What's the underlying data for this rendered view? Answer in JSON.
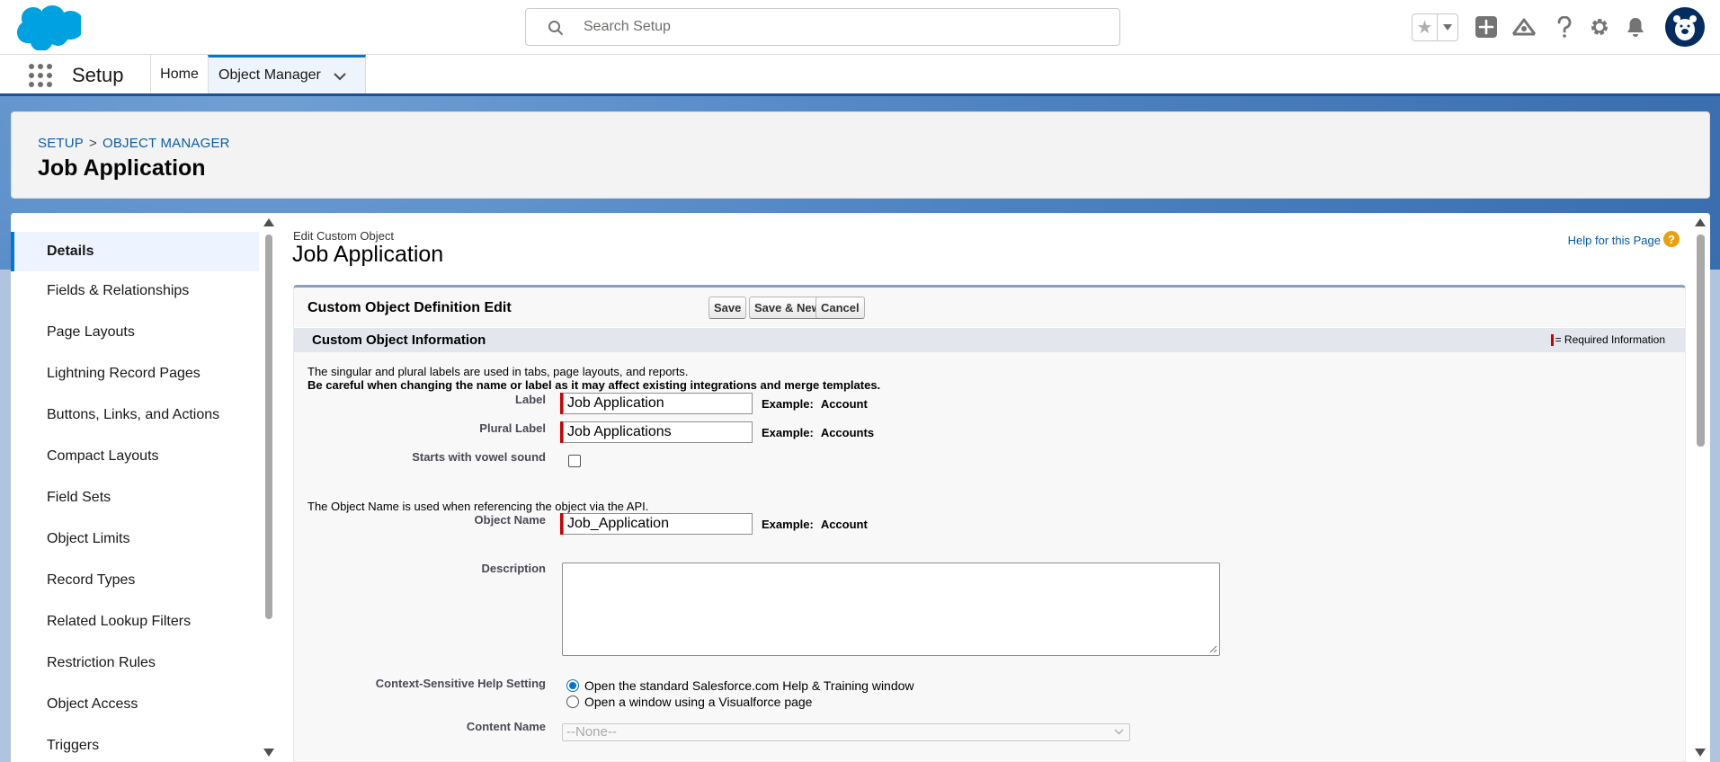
{
  "header": {
    "search_placeholder": "Search Setup",
    "icons": [
      "favorites-star-icon",
      "favorites-dropdown-icon",
      "global-create-icon",
      "trailhead-icon",
      "help-icon",
      "setup-gear-icon",
      "notifications-bell-icon",
      "user-avatar"
    ]
  },
  "context_bar": {
    "app_name": "Setup",
    "tabs": [
      {
        "label": "Home"
      },
      {
        "label": "Object Manager"
      }
    ]
  },
  "page_header": {
    "breadcrumb": [
      "SETUP",
      "OBJECT MANAGER"
    ],
    "breadcrumb_separator": ">",
    "title": "Job Application"
  },
  "sidebar": {
    "items": [
      {
        "label": "Details",
        "active": true
      },
      {
        "label": "Fields & Relationships"
      },
      {
        "label": "Page Layouts"
      },
      {
        "label": "Lightning Record Pages"
      },
      {
        "label": "Buttons, Links, and Actions"
      },
      {
        "label": "Compact Layouts"
      },
      {
        "label": "Field Sets"
      },
      {
        "label": "Object Limits"
      },
      {
        "label": "Record Types"
      },
      {
        "label": "Related Lookup Filters"
      },
      {
        "label": "Restriction Rules"
      },
      {
        "label": "Object Access"
      },
      {
        "label": "Triggers"
      }
    ]
  },
  "content": {
    "edit_label": "Edit Custom Object",
    "edit_title": "Job Application",
    "help_link": "Help for this Page",
    "help_icon_glyph": "?",
    "block_title": "Custom Object Definition Edit",
    "buttons": {
      "save": "Save",
      "save_new": "Save & New",
      "cancel": "Cancel"
    },
    "section_title": "Custom Object Information",
    "required_info": "= Required Information",
    "note_1": "The singular and plural labels are used in tabs, page layouts, and reports.",
    "note_2": "Be careful when changing the name or label as it may affect existing integrations and merge templates.",
    "note_3": "The Object Name is used when referencing the object via the API.",
    "fields": {
      "label": {
        "label": "Label",
        "value": "Job Application",
        "example_label": "Example:",
        "example_value": "Account"
      },
      "plural_label": {
        "label": "Plural Label",
        "value": "Job Applications",
        "example_label": "Example:",
        "example_value": "Accounts"
      },
      "vowel": {
        "label": "Starts with vowel sound",
        "checked": false
      },
      "object_name": {
        "label": "Object Name",
        "value": "Job_Application",
        "example_label": "Example:",
        "example_value": "Account"
      },
      "description": {
        "label": "Description",
        "value": ""
      },
      "help_setting": {
        "label": "Context-Sensitive Help Setting",
        "options": [
          "Open the standard Salesforce.com Help & Training window",
          "Open a window using a Visualforce page"
        ],
        "selected": 0
      },
      "content_name": {
        "label": "Content Name",
        "value": "--None--"
      }
    }
  },
  "colors": {
    "brand_blue": "#0176d3",
    "link_blue": "#0b5cab",
    "required_red": "#cc0000",
    "help_orange": "#e8a10a"
  }
}
